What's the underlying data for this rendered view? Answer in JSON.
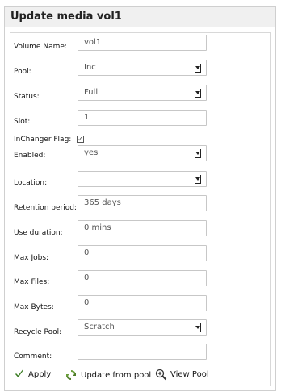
{
  "window": {
    "title": "Update media vol1"
  },
  "form": {
    "fields": [
      {
        "label": "Volume Name:",
        "type": "input",
        "value": "vol1"
      },
      {
        "label": "Pool:",
        "type": "select",
        "value": "Inc"
      },
      {
        "label": "Status:",
        "type": "select",
        "value": "Full"
      },
      {
        "label": "Slot:",
        "type": "input",
        "value": "1"
      },
      {
        "label": "InChanger Flag:",
        "type": "checkbox",
        "checked": true
      },
      {
        "label": "Enabled:",
        "type": "select",
        "value": "yes"
      },
      {
        "label": "Location:",
        "type": "select",
        "value": ""
      },
      {
        "label": "Retention period:",
        "type": "input",
        "value": "365 days"
      },
      {
        "label": "Use duration:",
        "type": "input",
        "value": "0 mins"
      },
      {
        "label": "Max Jobs:",
        "type": "input",
        "value": "0"
      },
      {
        "label": "Max Files:",
        "type": "input",
        "value": "0"
      },
      {
        "label": "Max Bytes:",
        "type": "input",
        "value": "0"
      },
      {
        "label": "Recycle Pool:",
        "type": "select",
        "value": "Scratch"
      },
      {
        "label": "Comment:",
        "type": "input",
        "value": ""
      }
    ]
  },
  "actions": {
    "apply": "Apply",
    "update_from_pool": "Update from pool",
    "view_pool": "View Pool"
  },
  "icons": {
    "apply": "checkmark-icon",
    "update_from_pool": "refresh-icon",
    "view_pool": "zoom-in-icon"
  },
  "colors": {
    "apply_icon": "#3a7d22",
    "refresh_icon": "#4f7d2a"
  }
}
